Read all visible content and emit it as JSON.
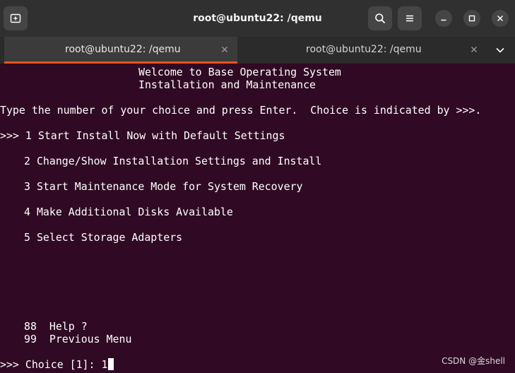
{
  "window": {
    "title": "root@ubuntu22: /qemu"
  },
  "icons": {
    "new_tab": "new-tab-icon",
    "search": "search-icon",
    "menu": "hamburger-menu-icon",
    "minimize": "minimize-icon",
    "maximize": "maximize-icon",
    "close": "close-icon",
    "tab_close": "close-icon",
    "tabs_dropdown": "chevron-down-icon"
  },
  "tabs": [
    {
      "label": "root@ubuntu22: /qemu",
      "active": true
    },
    {
      "label": "root@ubuntu22: /qemu",
      "active": false
    }
  ],
  "colors": {
    "terminal_background": "#300a24",
    "active_tab_accent": "#e95420",
    "headerbar": "#303030"
  },
  "terminal": {
    "welcome_line_1": "Welcome to Base Operating System",
    "welcome_line_2": "Installation and Maintenance",
    "instruction": "Type the number of your choice and press Enter.  Choice is indicated by >>>.",
    "default_marker": ">>>",
    "menu": [
      {
        "number": "1",
        "label": "Start Install Now with Default Settings"
      },
      {
        "number": "2",
        "label": "Change/Show Installation Settings and Install"
      },
      {
        "number": "3",
        "label": "Start Maintenance Mode for System Recovery"
      },
      {
        "number": "4",
        "label": "Make Additional Disks Available"
      },
      {
        "number": "5",
        "label": "Select Storage Adapters"
      }
    ],
    "extra_options": [
      {
        "number": "88",
        "label": "Help ?"
      },
      {
        "number": "99",
        "label": "Previous Menu"
      }
    ],
    "prompt_marker": ">>>",
    "prompt_label": "Choice [1]:",
    "prompt_input": "1"
  },
  "watermark": "CSDN @金shell"
}
